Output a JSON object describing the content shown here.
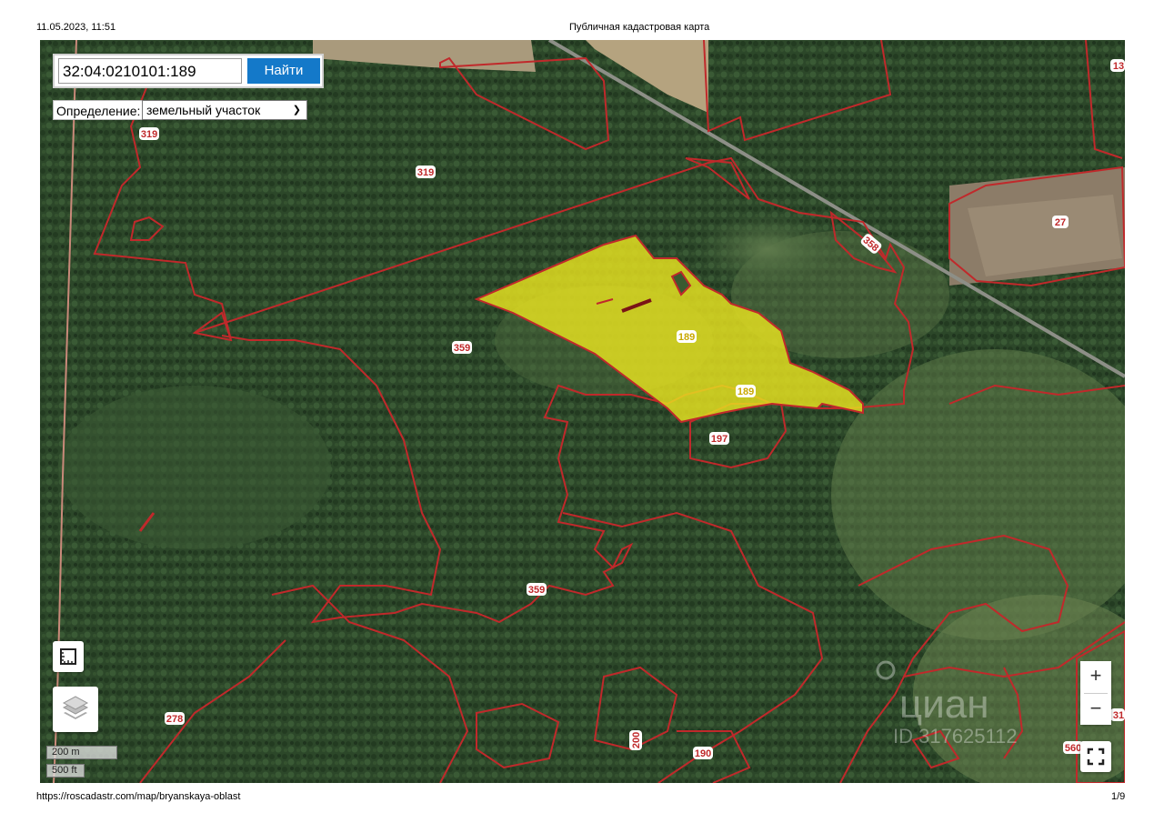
{
  "header": {
    "datetime": "11.05.2023, 11:51",
    "title": "Публичная кадастровая карта"
  },
  "footer": {
    "url": "https://roscadastr.com/map/bryanskaya-oblast",
    "page": "1/9"
  },
  "search": {
    "value": "32:04:0210101:189",
    "button_label": "Найти"
  },
  "definition": {
    "label": "Определение:",
    "selected": "земельный участок"
  },
  "parcel_labels": [
    "319",
    "319",
    "359",
    "359",
    "189",
    "189",
    "197",
    "358",
    "27",
    "278",
    "200",
    "190",
    "560",
    "13",
    "31"
  ],
  "scale": {
    "metric": "200 m",
    "imperial": "500 ft"
  },
  "zoom": {
    "in": "+",
    "out": "−"
  },
  "watermark": {
    "brand": "циан",
    "id": "ID 317625112"
  },
  "colors": {
    "boundary": "#c0292b",
    "highlight": "#e8e320",
    "button": "#1479c9",
    "forest": "#2f4a2c"
  },
  "icons": {
    "measure": "ruler-square-icon",
    "layers": "layers-icon",
    "fullscreen": "fullscreen-icon"
  }
}
